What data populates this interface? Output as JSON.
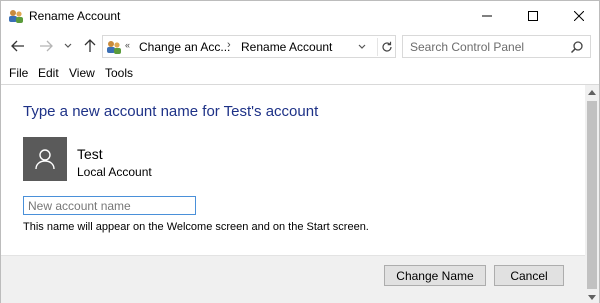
{
  "window": {
    "title": "Rename Account",
    "title_icon": "users-icon",
    "controls": [
      "minimize-icon",
      "maximize-icon",
      "close-icon"
    ]
  },
  "nav": {
    "back_icon": "arrow-left-icon",
    "forward_icon": "arrow-right-icon",
    "recent_icon": "chevron-down-icon",
    "up_icon": "arrow-up-icon",
    "address": {
      "overflow": "«",
      "crumbs": [
        "Change an Acc...",
        "Rename Account"
      ],
      "separator": "›"
    },
    "search_placeholder": "Search Control Panel"
  },
  "menu": {
    "items": [
      "File",
      "Edit",
      "View",
      "Tools"
    ]
  },
  "content": {
    "heading": "Type a new account name for Test's account",
    "user": {
      "name": "Test",
      "type": "Local Account"
    },
    "input_placeholder": "New account name",
    "input_value": "",
    "hint": "This name will appear on the Welcome screen and on the Start screen."
  },
  "buttons": {
    "change_name": "Change Name",
    "cancel": "Cancel"
  },
  "colors": {
    "heading": "#1e3287",
    "avatar_bg": "#5a5a5a",
    "input_focus": "#4a90d9",
    "footer_bg": "#f0f0f0"
  }
}
